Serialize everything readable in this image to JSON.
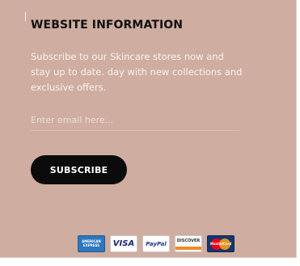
{
  "section": {
    "title": "WEBSITE INFORMATION",
    "description": "Subscribe to our Skincare stores now and stay up to date. day with new collections and exclusive offers."
  },
  "form": {
    "email_placeholder": "Enter email here...",
    "email_value": "",
    "subscribe_label": "SUBSCRIBE"
  },
  "payments": {
    "amex": [
      "AMERICAN",
      "EXPRESS"
    ],
    "visa": "VISA",
    "paypal": "PayPal",
    "discover": "DISCOVER",
    "mastercard": "MasterCard"
  },
  "colors": {
    "panel_background": "#cfada0",
    "button_background": "#0b0b0b",
    "title_text": "#111111",
    "body_text": "#faf3ef"
  },
  "icons": [
    "amex-card-icon",
    "visa-card-icon",
    "paypal-card-icon",
    "discover-card-icon",
    "mastercard-card-icon"
  ]
}
